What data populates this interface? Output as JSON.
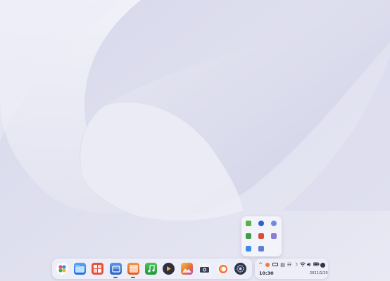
{
  "desktop": {
    "background_color": "#e6e6f1"
  },
  "tray_popup": {
    "items": [
      {
        "icon": "green-app-icon",
        "color": "#58b24a"
      },
      {
        "icon": "blue-globe-icon",
        "color": "#2f5fd0"
      },
      {
        "icon": "network-icon",
        "color": "#6d8be0"
      },
      {
        "icon": "green-shield-icon",
        "color": "#3f9b4f"
      },
      {
        "icon": "red-app-icon",
        "color": "#d94c3d"
      },
      {
        "icon": "purple-app-icon",
        "color": "#8a7fd6"
      },
      {
        "icon": "blue-chat-icon",
        "color": "#3d8be8"
      },
      {
        "icon": "blue-box-icon",
        "color": "#5f7bd8"
      }
    ]
  },
  "dock": {
    "apps": [
      {
        "name": "launcher-icon",
        "color": "#ffffff"
      },
      {
        "name": "file-manager-icon",
        "color": "#2f7fe6"
      },
      {
        "name": "app-store-icon",
        "color": "#e8503a"
      },
      {
        "name": "browser-icon",
        "color": "#3b73d9"
      },
      {
        "name": "package-icon",
        "color": "#e86a2a"
      },
      {
        "name": "music-icon",
        "color": "#2ea843"
      },
      {
        "name": "video-player-icon",
        "color": "#2c3040"
      },
      {
        "name": "image-viewer-icon",
        "color": "#f0a33a"
      },
      {
        "name": "camera-icon",
        "color": "#f2f3f7"
      },
      {
        "name": "color-picker-icon",
        "color": "#f7f2f0"
      },
      {
        "name": "settings-icon",
        "color": "#2d3348"
      }
    ]
  },
  "system_tray": {
    "time": "10:30",
    "date": "2021/1/20"
  }
}
